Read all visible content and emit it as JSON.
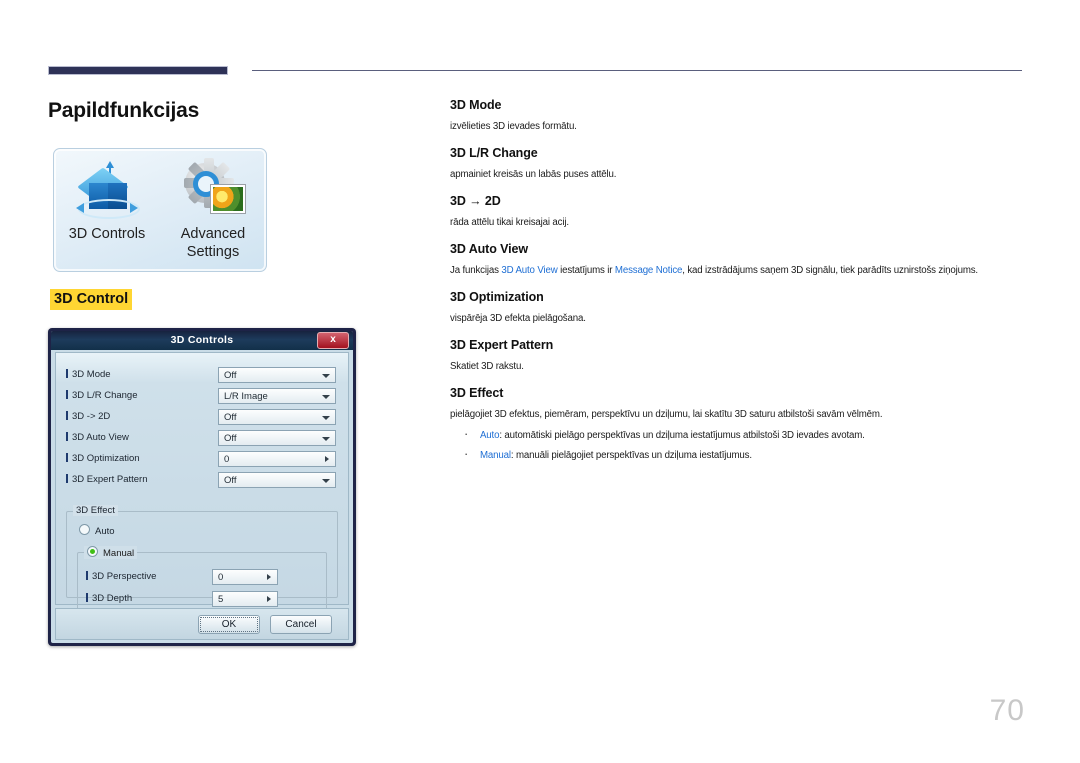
{
  "page": {
    "title": "Papildfunkcijas",
    "number": "70",
    "section_tag": "3D Control"
  },
  "icon_panel": {
    "items": [
      {
        "icon": "3d-cube-icon",
        "label": "3D Controls"
      },
      {
        "icon": "gear-picture-icon",
        "label": "Advanced\nSettings"
      }
    ],
    "labels": [
      "3D Controls",
      "Advanced Settings"
    ]
  },
  "dialog": {
    "title": "3D Controls",
    "close_label": "x",
    "fields": [
      {
        "label": "3D Mode",
        "value": "Off",
        "control": "dropdown"
      },
      {
        "label": "3D L/R Change",
        "value": "L/R Image",
        "control": "dropdown"
      },
      {
        "label": "3D -> 2D",
        "value": "Off",
        "control": "dropdown"
      },
      {
        "label": "3D Auto View",
        "value": "Off",
        "control": "dropdown"
      },
      {
        "label": "3D Optimization",
        "value": "0",
        "control": "spinner"
      },
      {
        "label": "3D Expert Pattern",
        "value": "Off",
        "control": "dropdown"
      }
    ],
    "effect_group": {
      "title": "3D Effect",
      "auto_label": "Auto",
      "auto_selected": false,
      "manual_label": "Manual",
      "manual_selected": true,
      "manual_fields": [
        {
          "label": "3D Perspective",
          "value": "0"
        },
        {
          "label": "3D Depth",
          "value": "5"
        }
      ]
    },
    "buttons": {
      "ok": "OK",
      "cancel": "Cancel"
    }
  },
  "topics": [
    {
      "head": "3D Mode",
      "desc": "izvēlieties 3D ievades formātu."
    },
    {
      "head": "3D L/R Change",
      "desc": "apmainiet kreisās un labās puses attēlu."
    },
    {
      "head": "3D → 2D",
      "desc": "rāda attēlu tikai kreisajai acij."
    },
    {
      "head": "3D Auto View",
      "desc_part1": "Ja funkcijas ",
      "desc_hl1": "3D Auto View",
      "desc_part2": " iestatījums ir ",
      "desc_hl2": "Message Notice",
      "desc_part3": ", kad izstrādājums saņem 3D signālu, tiek parādīts uznirstošs ziņojums."
    },
    {
      "head": "3D Optimization",
      "desc": "vispārēja 3D efekta pielāgošana."
    },
    {
      "head": "3D Expert Pattern",
      "desc": "Skatiet 3D rakstu."
    },
    {
      "head": "3D Effect",
      "desc": "pielāgojiet 3D efektus, piemēram, perspektīvu un dziļumu, lai skatītu 3D saturu atbilstoši savām vēlmēm.",
      "bullets": [
        {
          "term": "Auto",
          "text": ": automātiski pielāgo perspektīvas un dziļuma iestatījumus atbilstoši 3D ievades avotam."
        },
        {
          "term": "Manual",
          "text": ": manuāli pielāgojiet perspektīvas un dziļuma iestatījumus."
        }
      ]
    }
  ],
  "colors": {
    "rule": "#2e3257",
    "highlight": "#ffd633",
    "link": "#1f6fd4",
    "page_number": "#c8c8c8"
  }
}
